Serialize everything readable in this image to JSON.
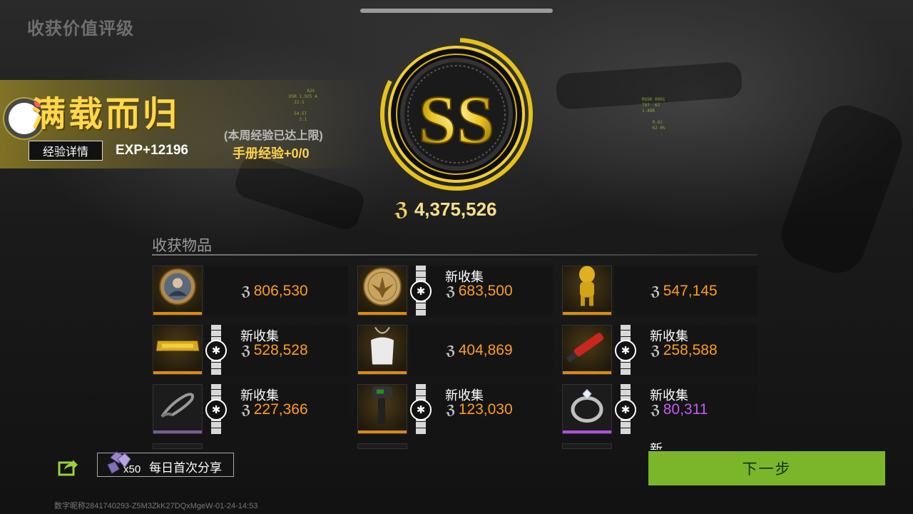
{
  "page_title": "收获价值评级",
  "banner": {
    "title": "满载而归",
    "exp_details_label": "经验详情",
    "exp_value": "EXP+12196",
    "week_limit_note": "(本周经验已达上限)",
    "handbook_exp": "手册经验+0/0"
  },
  "rating": {
    "grade": "SS",
    "total_value": "4,375,526",
    "coin_symbol": "ℨ"
  },
  "items_section": {
    "title": "收获物品",
    "new_label": "新收集",
    "items": [
      {
        "name": "portrait-coin",
        "price": "806,530",
        "is_new": false,
        "price_color": "#ff9d1e",
        "rarity_color": "#d98a12"
      },
      {
        "name": "gold-eagle-coin",
        "price": "683,500",
        "is_new": true,
        "price_color": "#ff9d1e",
        "rarity_color": "#d98a12"
      },
      {
        "name": "gold-figurine",
        "price": "547,145",
        "is_new": false,
        "price_color": "#ff9d1e",
        "rarity_color": "#d98a12"
      },
      {
        "name": "gold-bar",
        "price": "528,528",
        "is_new": true,
        "price_color": "#ff9d1e",
        "rarity_color": "#d98a12"
      },
      {
        "name": "white-top",
        "price": "404,869",
        "is_new": false,
        "price_color": "#ff9d1e",
        "rarity_color": "#d98a12"
      },
      {
        "name": "red-tool",
        "price": "258,588",
        "is_new": true,
        "price_color": "#ff9d1e",
        "rarity_color": "#d98a12"
      },
      {
        "name": "cord",
        "price": "227,366",
        "is_new": true,
        "price_color": "#ff9d1e",
        "rarity_color": "#7a5a9a"
      },
      {
        "name": "thermometer-gun",
        "price": "123,030",
        "is_new": true,
        "price_color": "#ff9d1e",
        "rarity_color": "#d98a12"
      },
      {
        "name": "diamond-ring",
        "price": "80,311",
        "is_new": true,
        "price_color": "#c35cf0",
        "rarity_color": "#b14fe0"
      }
    ],
    "partial_new_label": "新收集"
  },
  "share": {
    "reward_count": "x50",
    "label": "每日首次分享"
  },
  "next_button": "下一步",
  "footer_id": "数字昵称2841740293-Z5M3ZkK27DQxMgeW-01-24-14:53",
  "colors": {
    "gold": "#ffd84a",
    "accent_green": "#7bb62a",
    "orange_price": "#ff9d1e",
    "purple_price": "#c35cf0"
  }
}
